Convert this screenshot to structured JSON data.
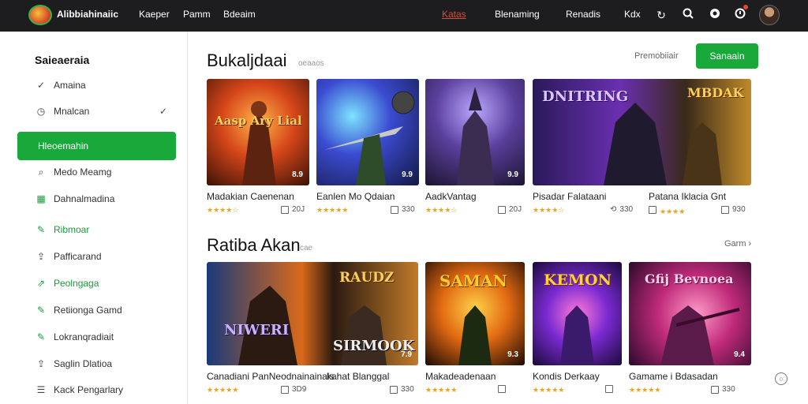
{
  "header": {
    "brand": "Alibbiahinaiic",
    "nav_left": [
      "Kaeper",
      "Pamm",
      "Bdeaim"
    ],
    "nav_right": [
      "Katas",
      "Blenaming",
      "Renadis",
      "Kdx"
    ],
    "active_nav": "Katas",
    "icons": [
      "refresh-icon",
      "search-icon",
      "chat-icon",
      "bell-icon"
    ]
  },
  "sidebar": {
    "title": "Saieaeraia",
    "items": [
      {
        "label": "Amaina",
        "icon": "check-icon",
        "green": false,
        "check": false
      },
      {
        "label": "Mnalcan",
        "icon": "clock-icon",
        "green": false,
        "check": true
      },
      {
        "label": "Hleoemahin",
        "icon": "",
        "green": false,
        "check": false,
        "active": true
      },
      {
        "label": "Medo Meamg",
        "icon": "search-icon",
        "green": false,
        "check": false
      },
      {
        "label": "Dahnalmadina",
        "icon": "grid-icon",
        "green": true,
        "check": false
      },
      {
        "label": "Ribmoar",
        "icon": "edit-icon",
        "green": true,
        "check": false
      },
      {
        "label": "Pafficarand",
        "icon": "upload-icon",
        "green": false,
        "check": false
      },
      {
        "label": "Peolngaga",
        "icon": "share-icon",
        "green": true,
        "check": false
      },
      {
        "label": "Retiionga Gamd",
        "icon": "edit-icon",
        "green": false,
        "check": false
      },
      {
        "label": "Lokranqradiait",
        "icon": "edit-icon",
        "green": false,
        "check": false
      },
      {
        "label": "Saglin Dlatioa",
        "icon": "upload-icon",
        "green": false,
        "check": false
      },
      {
        "label": "Kack Pengarlary",
        "icon": "list-icon",
        "green": false,
        "check": false
      }
    ]
  },
  "section1": {
    "title": "Bukaljdaai",
    "subtitle": "oeaaos",
    "filter": "Premobiiair",
    "button": "Sanaain",
    "cards": [
      {
        "title": "Madakian Caenenan",
        "badge": "8.9",
        "meta": "20J",
        "banner": "Aasp Ary Lial"
      },
      {
        "title": "Eanlen Mo Qdaian",
        "badge": "9.9",
        "meta": "330",
        "banner": ""
      },
      {
        "title": "AadkVantag",
        "badge": "9.9",
        "meta": "20J",
        "banner": ""
      },
      {
        "title": "Pisadar Falataani",
        "badge": "",
        "meta": "330",
        "banner": "DNITRING"
      },
      {
        "title": "Patana Iklacia Gnt",
        "badge": "",
        "meta": "930",
        "banner": "MBDAK"
      }
    ]
  },
  "section2": {
    "title": "Ratiba Akan",
    "subtitle": "cae",
    "filter": "Garm",
    "cards": [
      {
        "title": "Canadiani PanNeodnainainals",
        "badge": "",
        "meta": "3D9",
        "banner": "NIWERI"
      },
      {
        "title": "kahat Blanggal",
        "badge": "7.9",
        "meta": "330",
        "banner": "RAUDZ"
      },
      {
        "title": "Makadeadenaan",
        "badge": "9.3",
        "meta": "",
        "banner": "SAMAN"
      },
      {
        "title": "Kondis Derkaay",
        "badge": "",
        "meta": "",
        "banner": "KEMON"
      },
      {
        "title": "Gamame i Bdasadan",
        "badge": "9.4",
        "meta": "330",
        "banner": "Gfij Bevnoea"
      }
    ]
  },
  "colors": {
    "accent_green": "#19a93a",
    "header_bg": "#1d1d1f",
    "active_nav": "#e2482d",
    "star": "#f1a11a"
  }
}
